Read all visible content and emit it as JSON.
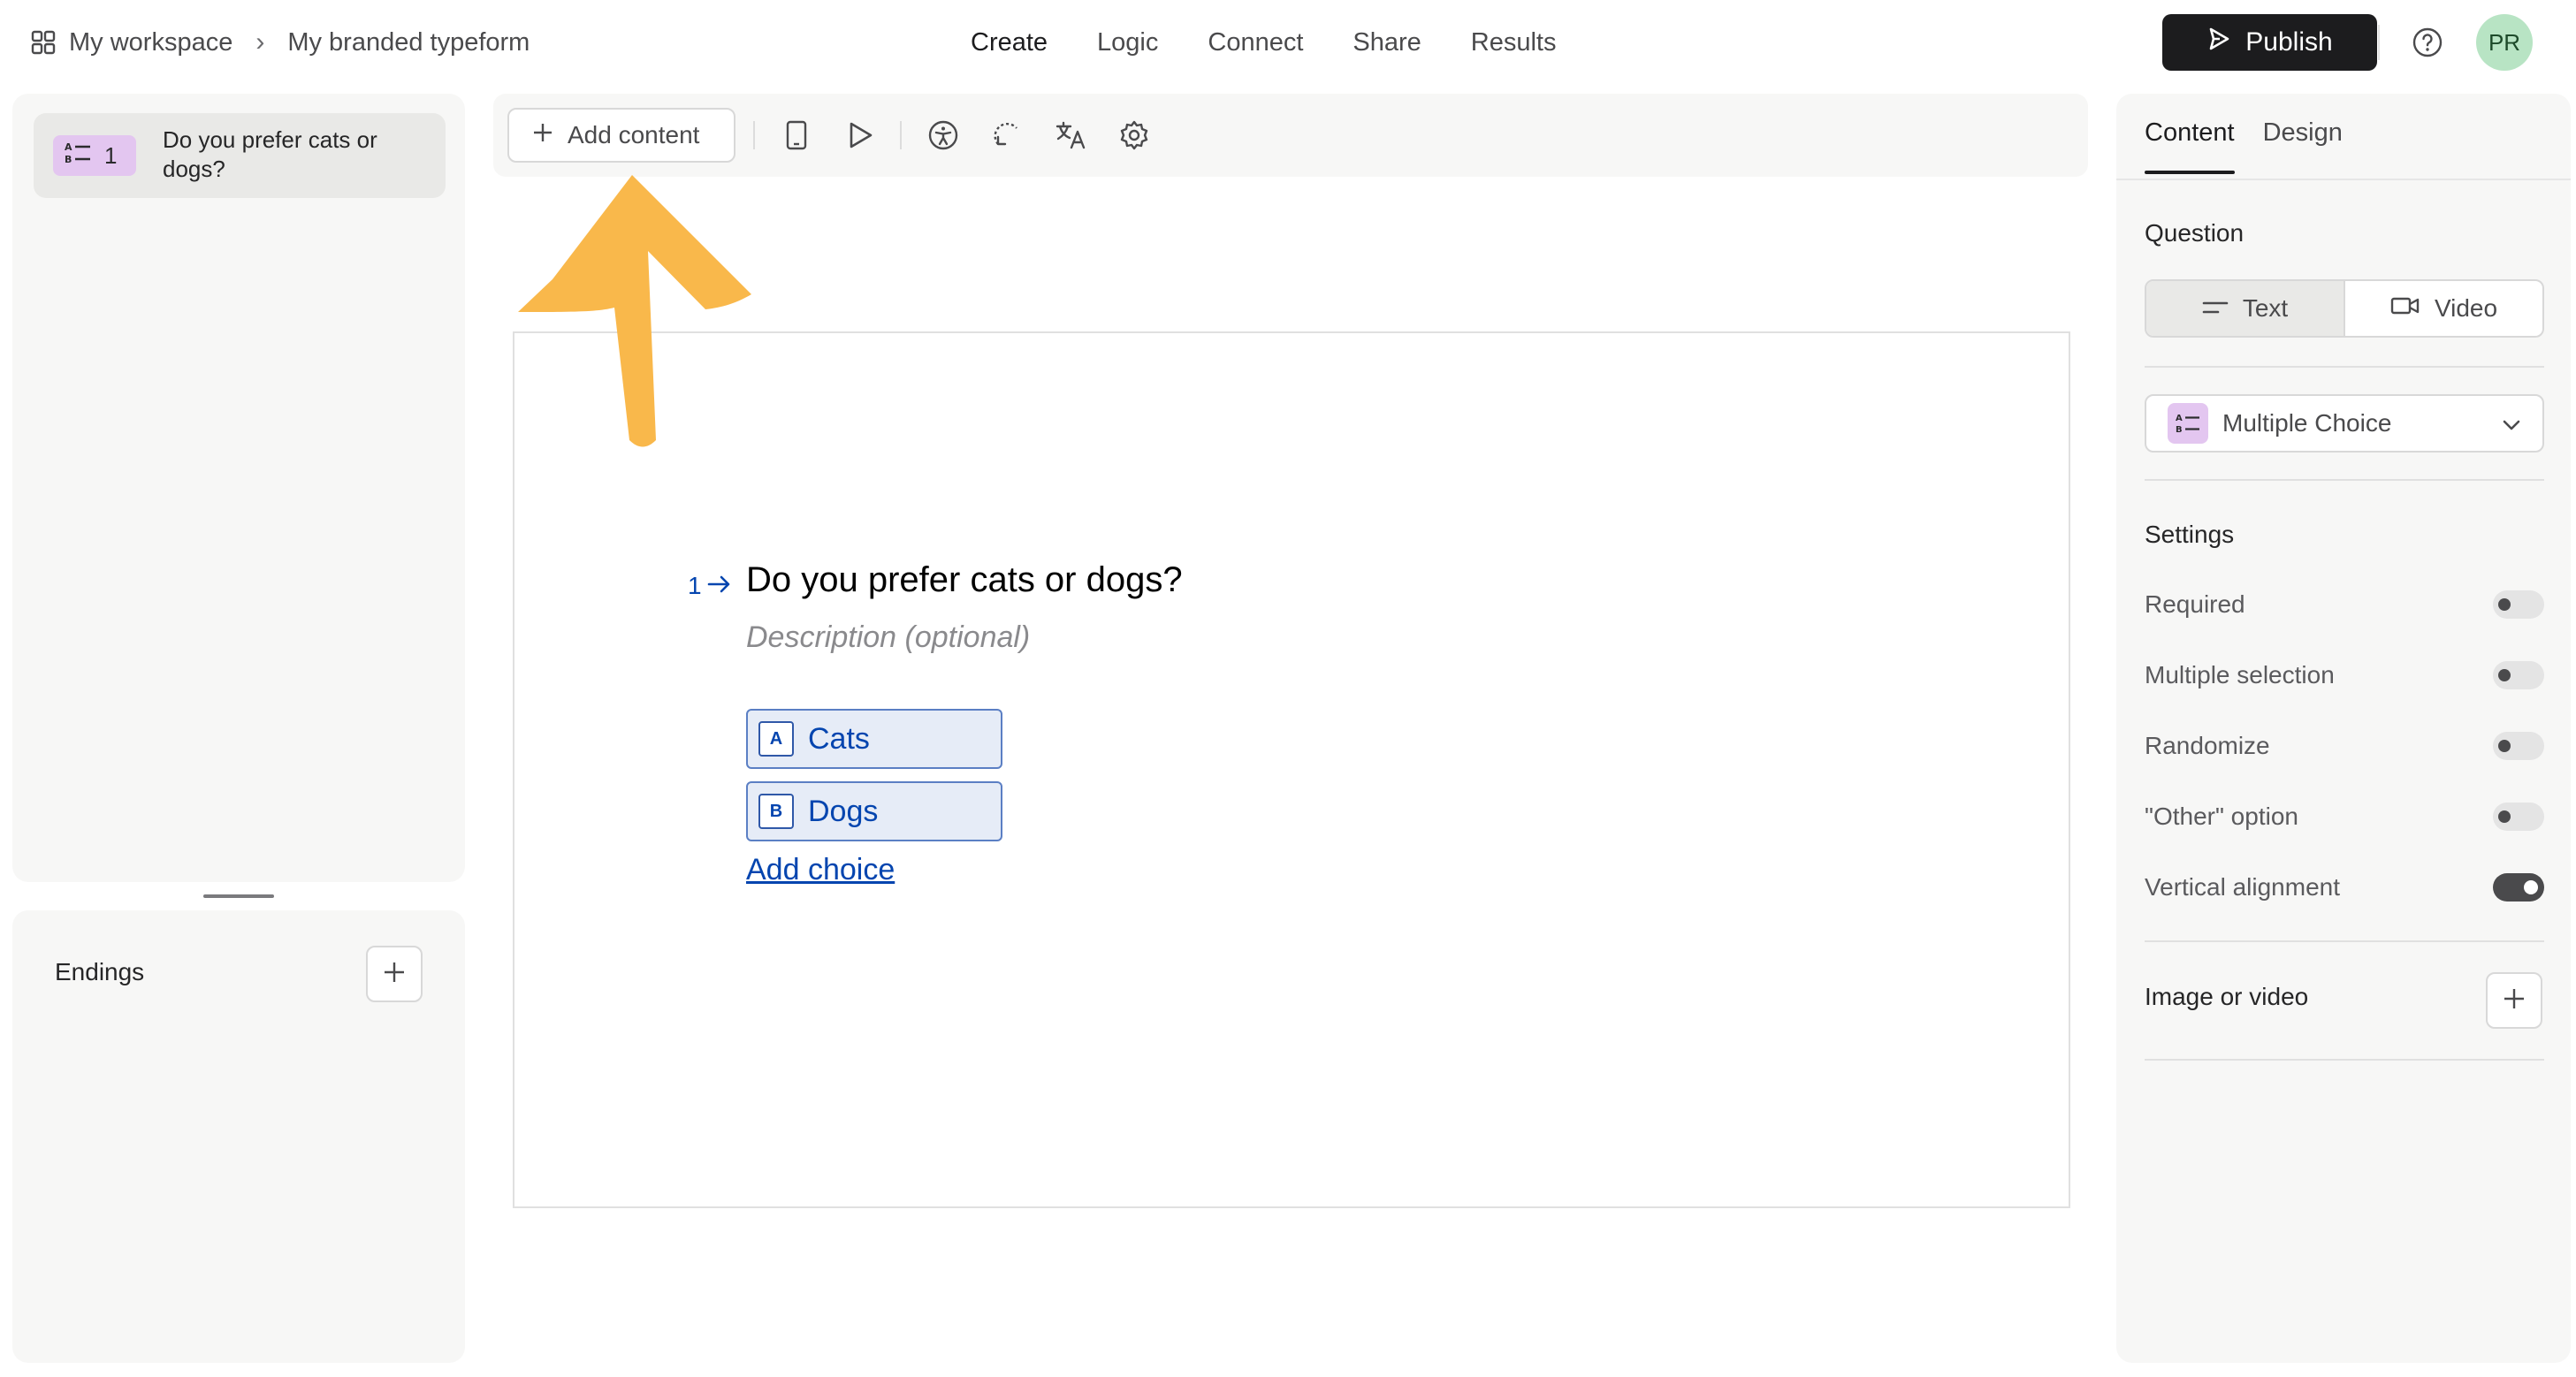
{
  "breadcrumb": {
    "workspace": "My workspace",
    "separator": "›",
    "form": "My branded typeform"
  },
  "nav": {
    "create": "Create",
    "logic": "Logic",
    "connect": "Connect",
    "share": "Share",
    "results": "Results"
  },
  "publish_label": "Publish",
  "avatar_initials": "PR",
  "questions_panel": {
    "items": [
      {
        "number": "1",
        "text": "Do you prefer cats or dogs?",
        "type_icon": "multiple-choice-icon"
      }
    ]
  },
  "endings_panel": {
    "label": "Endings"
  },
  "toolbar": {
    "add_content_label": "Add content",
    "icons": [
      "mobile-preview-icon",
      "play-icon",
      "accessibility-icon",
      "refresh-icon",
      "translate-icon",
      "settings-icon"
    ]
  },
  "question": {
    "number": "1",
    "title": "Do you prefer cats or dogs?",
    "description_placeholder": "Description (optional)",
    "choices": [
      {
        "key": "A",
        "label": "Cats"
      },
      {
        "key": "B",
        "label": "Dogs"
      }
    ],
    "add_choice_label": "Add choice"
  },
  "right_panel": {
    "tabs": {
      "content": "Content",
      "design": "Design"
    },
    "question_label": "Question",
    "question_format": {
      "text": "Text",
      "video": "Video",
      "selected": "Text"
    },
    "question_type": "Multiple Choice",
    "settings_label": "Settings",
    "settings": [
      {
        "label": "Required",
        "on": false
      },
      {
        "label": "Multiple selection",
        "on": false
      },
      {
        "label": "Randomize",
        "on": false
      },
      {
        "label": "\"Other\" option",
        "on": false
      },
      {
        "label": "Vertical alignment",
        "on": true
      }
    ],
    "media_label": "Image or video"
  },
  "colors": {
    "accent": "#0445af",
    "publish": "#1c1c1e",
    "arrow": "#f9b84b",
    "badge": "#e3c6f0",
    "avatar": "#b8e4c4"
  }
}
